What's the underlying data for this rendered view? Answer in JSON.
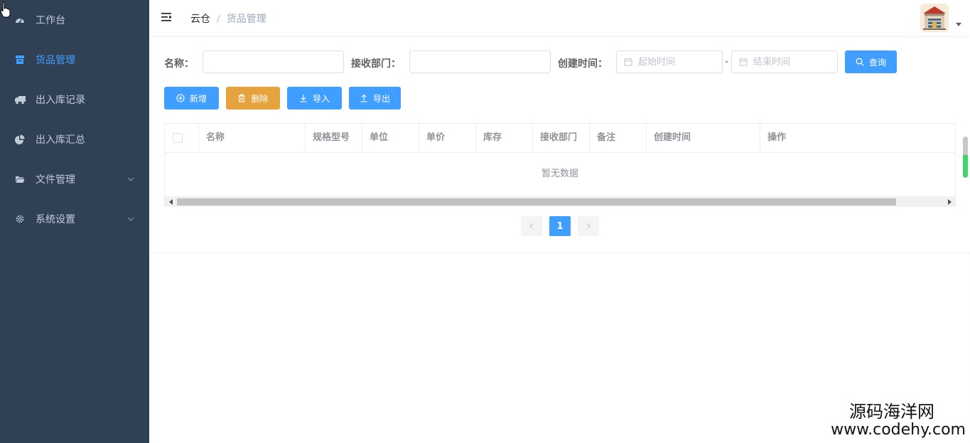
{
  "sidebar": {
    "items": [
      {
        "label": "工作台",
        "icon": "dashboard-icon",
        "active": false,
        "expandable": false
      },
      {
        "label": "货品管理",
        "icon": "goods-icon",
        "active": true,
        "expandable": false
      },
      {
        "label": "出入库记录",
        "icon": "truck-icon",
        "active": false,
        "expandable": false
      },
      {
        "label": "出入库汇总",
        "icon": "pie-chart-icon",
        "active": false,
        "expandable": false
      },
      {
        "label": "文件管理",
        "icon": "folder-icon",
        "active": false,
        "expandable": true
      },
      {
        "label": "系统设置",
        "icon": "gear-icon",
        "active": false,
        "expandable": true
      }
    ],
    "background": "#304156",
    "text_color": "#bfcbd9",
    "active_color": "#409eff"
  },
  "breadcrumb": {
    "home": "云仓",
    "separator": "/",
    "current": "货品管理"
  },
  "filters": {
    "name_label": "名称：",
    "name_value": "",
    "dept_label": "接收部门：",
    "dept_value": "",
    "created_label": "创建时间：",
    "start_placeholder": "起始时间",
    "end_placeholder": "结束时间",
    "range_separator": "-",
    "query_label": "查询"
  },
  "toolbar": {
    "add_label": "新增",
    "delete_label": "删除",
    "import_label": "导入",
    "export_label": "导出"
  },
  "table": {
    "columns": [
      "名称",
      "规格型号",
      "单位",
      "单价",
      "库存",
      "接收部门",
      "备注",
      "创建时间",
      "操作"
    ],
    "empty_text": "暂无数据",
    "rows": []
  },
  "pagination": {
    "current_page": "1"
  },
  "watermark": {
    "line1": "源码海洋网",
    "line2": "www.codehy.com"
  },
  "colors": {
    "primary": "#409eff",
    "warning": "#e6a23c"
  }
}
